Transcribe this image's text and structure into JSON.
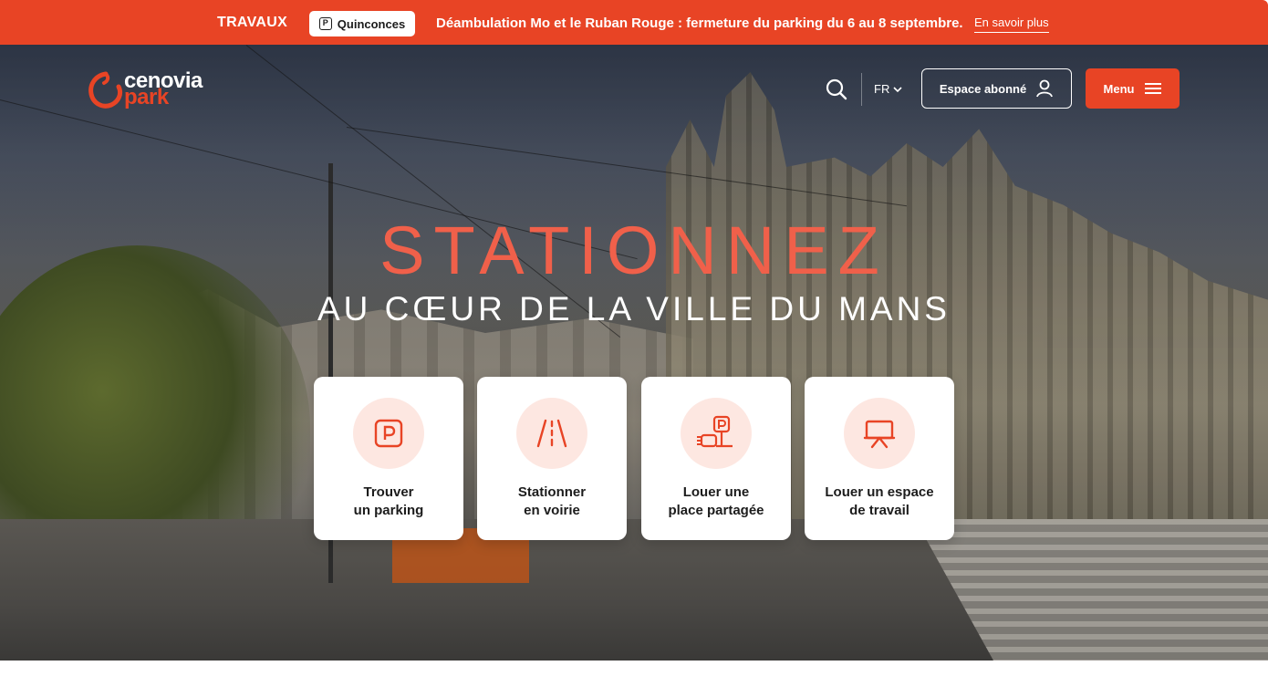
{
  "banner": {
    "label": "TRAVAUX",
    "pill_icon": "parking-p-icon",
    "pill_text": "Quinconces",
    "message": "Déambulation Mo et le Ruban Rouge : fermeture du parking du 6 au 8 septembre.",
    "link": "En savoir plus"
  },
  "header": {
    "logo_line1": "cenovia",
    "logo_line2": "park",
    "search_icon": "search-icon",
    "language": "FR",
    "subscriber_button": "Espace abonné",
    "menu_button": "Menu"
  },
  "hero": {
    "title": "STATIONNEZ",
    "subtitle": "AU CŒUR DE LA VILLE DU MANS"
  },
  "cards": [
    {
      "line1": "Trouver",
      "line2": "un parking",
      "icon": "parking-icon"
    },
    {
      "line1": "Stationner",
      "line2": "en voirie",
      "icon": "road-icon"
    },
    {
      "line1": "Louer une",
      "line2": "place partagée",
      "icon": "shared-parking-icon"
    },
    {
      "line1": "Louer un espace",
      "line2": "de travail",
      "icon": "presentation-board-icon"
    }
  ],
  "colors": {
    "brand_red": "#e84425",
    "title_salmon": "#f0604a",
    "icon_bg": "#fde7e1"
  }
}
